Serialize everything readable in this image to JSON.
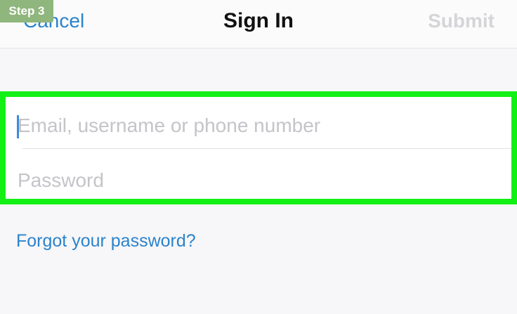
{
  "nav": {
    "cancel_label": "Cancel",
    "title": "Sign In",
    "submit_label": "Submit"
  },
  "step_badge": "Step 3",
  "form": {
    "email_placeholder": "Email, username or phone number",
    "password_placeholder": "Password"
  },
  "forgot_label": "Forgot your password?",
  "colors": {
    "accent": "#2a83cc",
    "highlight": "#12f016",
    "badge": "#8fb67c"
  }
}
